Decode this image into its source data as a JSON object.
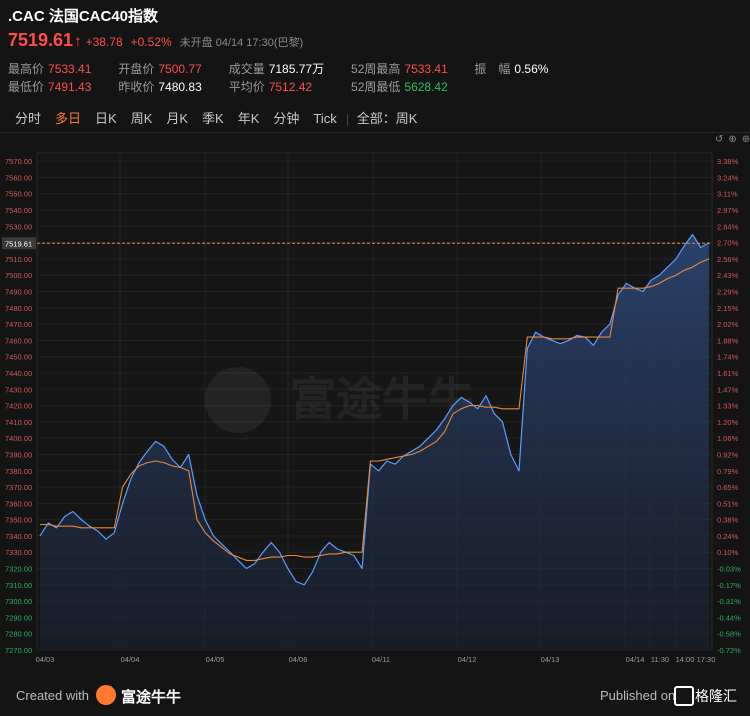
{
  "header": {
    "title": ".CAC 法国CAC40指数",
    "price": "7519.61",
    "change": "+38.78",
    "change_pct": "+0.52%",
    "status": "未开盘  04/14 17:30(巴黎)"
  },
  "stats": {
    "high_label": "最高价",
    "high": "7533.41",
    "open_label": "开盘价",
    "open": "7500.77",
    "volume_label": "成交量",
    "volume": "7185.77万",
    "wk52_high_label": "52周最高",
    "wk52_high": "7533.41",
    "amp_label": "振　幅",
    "amp": "0.56%",
    "low_label": "最低价",
    "low": "7491.43",
    "prev_close_label": "昨收价",
    "prev_close": "7480.83",
    "avg_label": "平均价",
    "avg": "7512.42",
    "wk52_low_label": "52周最低",
    "wk52_low": "5628.42"
  },
  "tabs": [
    "分时",
    "多日",
    "日K",
    "周K",
    "月K",
    "季K",
    "年K",
    "分钟",
    "Tick"
  ],
  "tab_active": "多日",
  "tab_all": "全部：周K",
  "colors": {
    "up": "#ff4d4d",
    "down": "#22c55e",
    "price_line": "#5b9dff",
    "avg_line": "#e8893a",
    "accent": "#ff7a2f"
  },
  "chart_data": {
    "type": "line",
    "title": "",
    "ylim": [
      7270,
      7575
    ],
    "y_ticks": [
      "7570.00",
      "7560.00",
      "7550.00",
      "7540.00",
      "7530.00",
      "7520.00",
      "7510.00",
      "7500.00",
      "7490.00",
      "7480.00",
      "7470.00",
      "7460.00",
      "7450.00",
      "7440.00",
      "7430.00",
      "7420.00",
      "7410.00",
      "7400.00",
      "7390.00",
      "7380.00",
      "7370.00",
      "7360.00",
      "7350.00",
      "7340.00",
      "7330.00",
      "7320.00",
      "7310.00",
      "7300.00",
      "7290.00",
      "7280.00",
      "7270.00"
    ],
    "pct_ticks": [
      "3.38%",
      "3.24%",
      "3.11%",
      "2.97%",
      "2.84%",
      "2.70%",
      "2.56%",
      "2.43%",
      "2.29%",
      "2.15%",
      "2.02%",
      "1.88%",
      "1.74%",
      "1.61%",
      "1.47%",
      "1.33%",
      "1.20%",
      "1.06%",
      "0.92%",
      "0.79%",
      "0.65%",
      "0.51%",
      "0.38%",
      "0.24%",
      "0.10%",
      "-0.03%",
      "-0.17%",
      "-0.31%",
      "-0.44%",
      "-0.58%",
      "-0.72%"
    ],
    "x_labels": [
      "04/03",
      "04/04",
      "04/05",
      "04/06",
      "04/11",
      "04/12",
      "04/13",
      "04/14",
      "11:30",
      "14:00",
      "17:30"
    ],
    "current_price": 7519.61,
    "series": [
      {
        "name": "价格",
        "values": [
          7340,
          7348,
          7345,
          7352,
          7355,
          7350,
          7346,
          7343,
          7338,
          7342,
          7360,
          7375,
          7385,
          7392,
          7398,
          7395,
          7387,
          7382,
          7390,
          7365,
          7350,
          7340,
          7335,
          7330,
          7325,
          7320,
          7323,
          7330,
          7336,
          7330,
          7320,
          7312,
          7310,
          7318,
          7330,
          7336,
          7332,
          7330,
          7328,
          7320,
          7384,
          7380,
          7386,
          7384,
          7389,
          7392,
          7395,
          7400,
          7405,
          7412,
          7420,
          7425,
          7422,
          7418,
          7426,
          7415,
          7410,
          7390,
          7380,
          7455,
          7465,
          7462,
          7460,
          7458,
          7460,
          7463,
          7462,
          7457,
          7465,
          7470,
          7488,
          7495,
          7492,
          7490,
          7497,
          7500,
          7505,
          7510,
          7518,
          7525,
          7517,
          7520
        ]
      },
      {
        "name": "均价",
        "values": [
          7347,
          7347,
          7346,
          7346,
          7346,
          7345,
          7345,
          7345,
          7345,
          7345,
          7370,
          7378,
          7383,
          7385,
          7386,
          7385,
          7383,
          7382,
          7380,
          7350,
          7342,
          7337,
          7333,
          7329,
          7327,
          7325,
          7325,
          7326,
          7327,
          7327,
          7328,
          7328,
          7327,
          7327,
          7328,
          7329,
          7329,
          7330,
          7330,
          7330,
          7386,
          7386,
          7387,
          7388,
          7389,
          7390,
          7392,
          7395,
          7398,
          7404,
          7415,
          7418,
          7420,
          7420,
          7419,
          7419,
          7418,
          7418,
          7418,
          7462,
          7462,
          7462,
          7461,
          7461,
          7461,
          7462,
          7462,
          7462,
          7462,
          7462,
          7492,
          7492,
          7492,
          7492,
          7493,
          7495,
          7498,
          7500,
          7503,
          7505,
          7508,
          7510
        ]
      }
    ]
  },
  "footer": {
    "created": "Created with",
    "brand": "富途牛牛",
    "published": "Published on",
    "publisher": "格隆汇"
  },
  "watermark": "富途牛牛"
}
